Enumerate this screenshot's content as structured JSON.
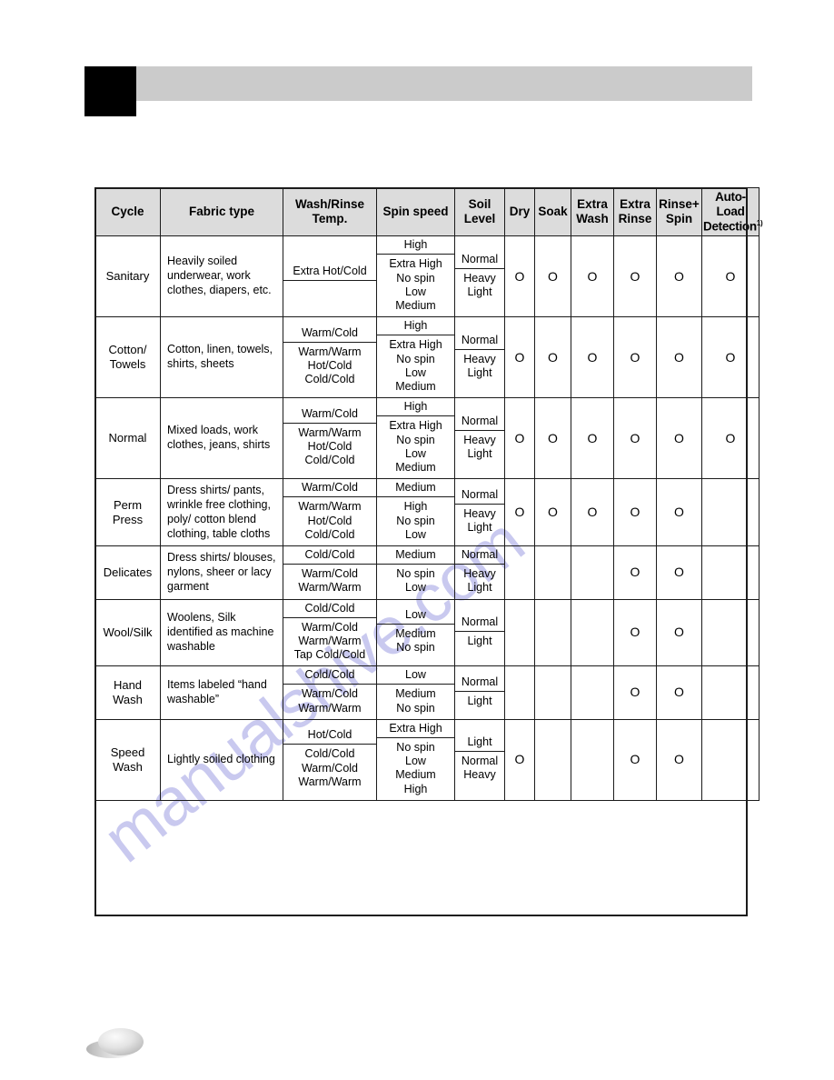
{
  "header": {
    "black_box": "",
    "gray_bar": ""
  },
  "watermark": {
    "text": "manualshive.com",
    "color": "#c9c9ef"
  },
  "table": {
    "columns": [
      "Cycle",
      "Fabric type",
      "Wash/Rinse Temp.",
      "Spin speed",
      "Soil Level",
      "Dry",
      "Soak",
      "Extra Wash",
      "Extra Rinse",
      "Rinse+ Spin",
      "Auto-Load Detection"
    ],
    "columns_multiline": {
      "wash_rinse_line1": "Wash/Rinse",
      "wash_rinse_line2": "Temp.",
      "spin_speed": "Spin speed",
      "soil_line1": "Soil",
      "soil_line2": "Level",
      "dry": "Dry",
      "soak": "Soak",
      "extra_wash_line1": "Extra",
      "extra_wash_line2": "Wash",
      "extra_rinse_line1": "Extra",
      "extra_rinse_line2": "Rinse",
      "rinse_spin_line1": "Rinse+",
      "rinse_spin_line2": "Spin",
      "auto_line1": "Auto-Load",
      "auto_line2": "Detection",
      "auto_sup": "1)"
    },
    "mark": "O",
    "rows": [
      {
        "cycle": "Sanitary",
        "fabric": "Heavily soiled underwear, work clothes, diapers, etc.",
        "temp_top": "Extra Hot/Cold",
        "temp_bottom": "",
        "spin_top": "High",
        "spin_bottom": "Extra High\nNo spin\nLow\nMedium",
        "soil_top": "Normal",
        "soil_bottom": "Heavy\nLight",
        "dry": "O",
        "soak": "O",
        "extra_wash": "O",
        "extra_rinse": "O",
        "rinse_spin": "O",
        "auto_load": "O"
      },
      {
        "cycle": "Cotton/\nTowels",
        "fabric": "Cotton, linen, towels, shirts, sheets",
        "temp_top": "Warm/Cold",
        "temp_bottom": "Warm/Warm\nHot/Cold\nCold/Cold",
        "spin_top": "High",
        "spin_bottom": "Extra High\nNo spin\nLow\nMedium",
        "soil_top": "Normal",
        "soil_bottom": "Heavy\nLight",
        "dry": "O",
        "soak": "O",
        "extra_wash": "O",
        "extra_rinse": "O",
        "rinse_spin": "O",
        "auto_load": "O"
      },
      {
        "cycle": "Normal",
        "fabric": "Mixed loads, work clothes, jeans, shirts",
        "temp_top": "Warm/Cold",
        "temp_bottom": "Warm/Warm\nHot/Cold\nCold/Cold",
        "spin_top": "High",
        "spin_bottom": "Extra High\nNo spin\nLow\nMedium",
        "soil_top": "Normal",
        "soil_bottom": "Heavy\nLight",
        "dry": "O",
        "soak": "O",
        "extra_wash": "O",
        "extra_rinse": "O",
        "rinse_spin": "O",
        "auto_load": "O"
      },
      {
        "cycle": "Perm\nPress",
        "fabric": "Dress shirts/ pants, wrinkle free clothing, poly/ cotton blend clothing, table cloths",
        "temp_top": "Warm/Cold",
        "temp_bottom": "Warm/Warm\nHot/Cold\nCold/Cold",
        "spin_top": "Medium",
        "spin_bottom": "High\nNo spin\nLow",
        "soil_top": "Normal",
        "soil_bottom": "Heavy\nLight",
        "dry": "O",
        "soak": "O",
        "extra_wash": "O",
        "extra_rinse": "O",
        "rinse_spin": "O",
        "auto_load": ""
      },
      {
        "cycle": "Delicates",
        "fabric": "Dress shirts/ blouses, nylons, sheer or lacy garment",
        "temp_top": "Cold/Cold",
        "temp_bottom": "Warm/Cold\nWarm/Warm",
        "spin_top": "Medium",
        "spin_bottom": "No spin\nLow",
        "soil_top": "Normal",
        "soil_bottom": "Heavy\nLight",
        "dry": "",
        "soak": "",
        "extra_wash": "",
        "extra_rinse": "O",
        "rinse_spin": "O",
        "auto_load": ""
      },
      {
        "cycle": "Wool/Silk",
        "fabric": "Woolens, Silk identified as machine washable",
        "temp_top": "Cold/Cold",
        "temp_bottom": "Warm/Cold\nWarm/Warm\nTap Cold/Cold",
        "spin_top": "Low",
        "spin_bottom": "Medium\nNo spin",
        "soil_top": "Normal",
        "soil_bottom": "Light",
        "dry": "",
        "soak": "",
        "extra_wash": "",
        "extra_rinse": "O",
        "rinse_spin": "O",
        "auto_load": ""
      },
      {
        "cycle": "Hand\nWash",
        "fabric": "Items labeled “hand washable”",
        "temp_top": "Cold/Cold",
        "temp_bottom": "Warm/Cold\nWarm/Warm",
        "spin_top": "Low",
        "spin_bottom": "Medium\nNo spin",
        "soil_top": "Normal",
        "soil_bottom": "Light",
        "dry": "",
        "soak": "",
        "extra_wash": "",
        "extra_rinse": "O",
        "rinse_spin": "O",
        "auto_load": ""
      },
      {
        "cycle": "Speed\nWash",
        "fabric": "Lightly soiled clothing",
        "temp_top": "Hot/Cold",
        "temp_bottom": "Cold/Cold\nWarm/Cold\nWarm/Warm",
        "spin_top": "Extra High",
        "spin_bottom": "No spin\nLow\nMedium\nHigh",
        "soil_top": "Light",
        "soil_bottom": "Normal\nHeavy",
        "dry": "O",
        "soak": "",
        "extra_wash": "",
        "extra_rinse": "O",
        "rinse_spin": "O",
        "auto_load": ""
      }
    ]
  }
}
